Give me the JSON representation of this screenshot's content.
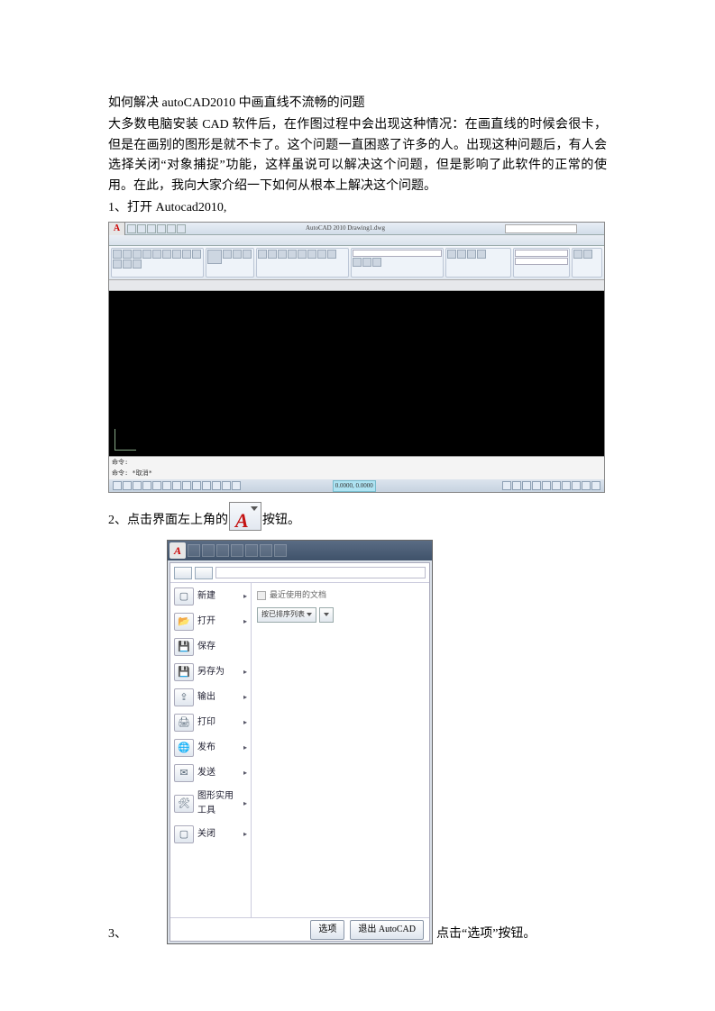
{
  "title": "如何解决 autoCAD2010 中画直线不流畅的问题",
  "para1": "大多数电脑安装 CAD 软件后，在作图过程中会出现这种情况：在画直线的时候会很卡，但是在画别的图形是就不卡了。这个问题一直困惑了许多的人。出现这种问题后，有人会选择关闭“对象捕捉”功能，这样虽说可以解决这个问题，但是影响了此软件的正常的使用。在此，我向大家介绍一下如何从根本上解决这个问题。",
  "step1": "1、打开 Autocad2010,",
  "step2_a": "2、点击界面左上角的",
  "step2_b": "按钮。",
  "step3_a": "3、",
  "step3_b": "点击“选项”按钮。",
  "shot1": {
    "title": "AutoCAD 2010   Drawing1.dwg",
    "cmd1": "命令:",
    "cmd2": "命令: *取消*",
    "coords": "0.0000, 0.0000"
  },
  "shot2": {
    "recent": "最近使用的文档",
    "sort": "按已排序列表",
    "m_new": "新建",
    "m_open": "打开",
    "m_save": "保存",
    "m_saveas": "另存为",
    "m_export": "输出",
    "m_print": "打印",
    "m_publish": "发布",
    "m_send": "发送",
    "m_util": "图形实用工具",
    "m_close": "关闭",
    "btn_opt": "选项",
    "btn_exit": "退出 AutoCAD"
  }
}
